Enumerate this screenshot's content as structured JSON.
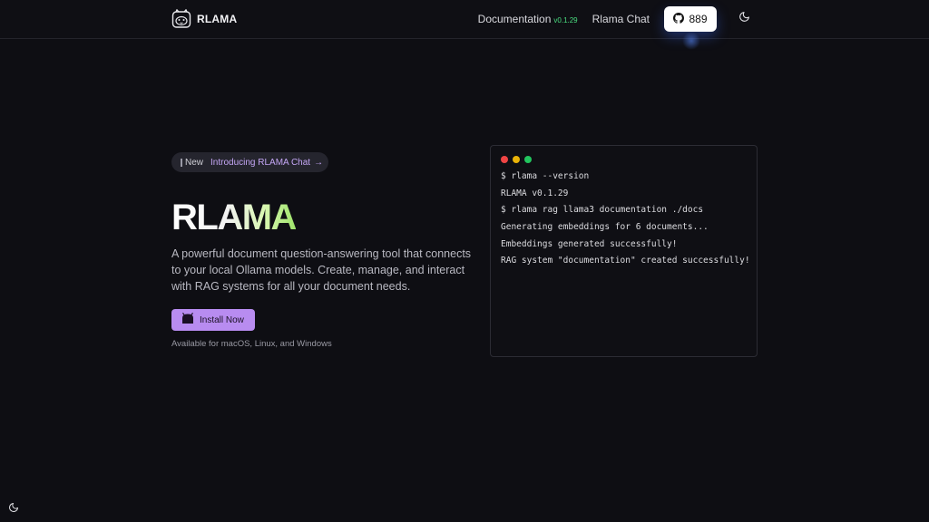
{
  "header": {
    "brand": "RLAMA",
    "nav": {
      "docs_label": "Documentation",
      "docs_version": "v0.1.29",
      "chat_label": "Rlama Chat"
    },
    "github": {
      "icon": "github-icon",
      "stars": "889"
    },
    "theme_icon": "moon-icon"
  },
  "hero": {
    "pill": {
      "badge": "New",
      "text": "Introducing RLAMA Chat",
      "arrow": "→"
    },
    "title": "RLAMA",
    "description": "A powerful document question-answering tool that connects to your local Ollama models. Create, manage, and interact with RAG systems for all your document needs.",
    "install_label": "Install Now",
    "availability": "Available for macOS, Linux, and Windows"
  },
  "terminal": {
    "dots": [
      "#ef4444",
      "#eab308",
      "#22c55e"
    ],
    "lines": [
      "$ rlama --version",
      "RLAMA v0.1.29",
      "$ rlama rag llama3 documentation ./docs",
      "Generating embeddings for 6 documents...",
      "Embeddings generated successfully!",
      "RAG system \"documentation\" created successfully!"
    ]
  },
  "colors": {
    "background": "#0e0e13",
    "accent": "#b88cf0",
    "version": "#4ade80"
  }
}
